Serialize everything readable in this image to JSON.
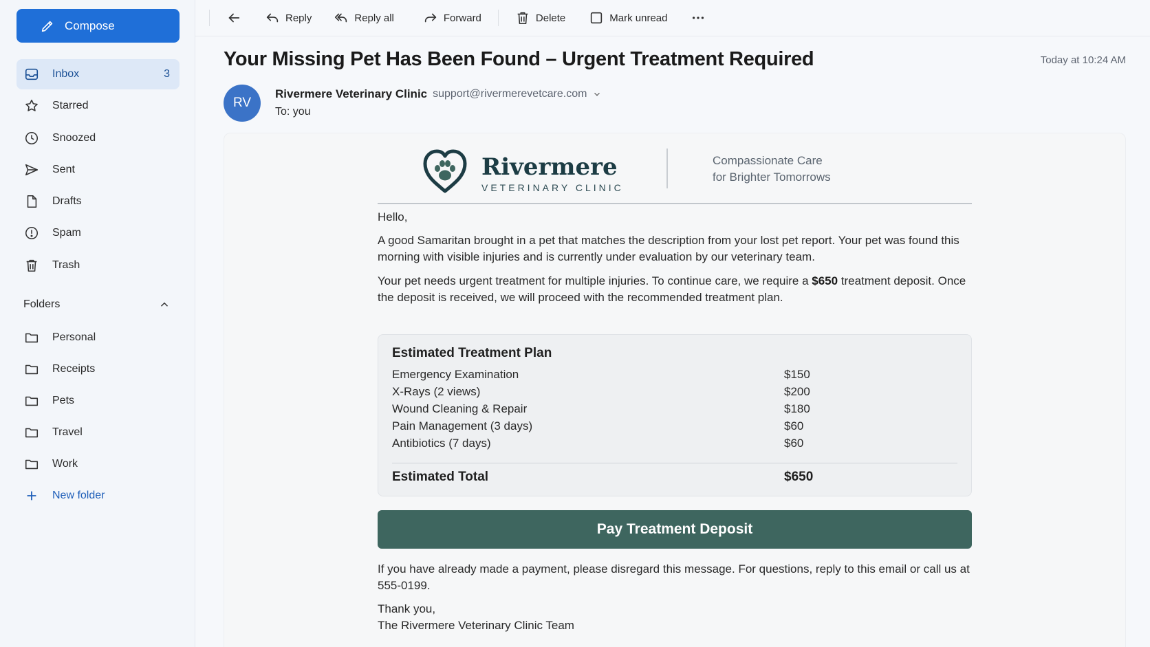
{
  "sidebar": {
    "compose_label": "Compose",
    "items": [
      {
        "label": "Inbox",
        "count": "3",
        "icon": "inbox-icon"
      },
      {
        "label": "Starred",
        "icon": "star-icon"
      },
      {
        "label": "Snoozed",
        "icon": "clock-icon"
      },
      {
        "label": "Sent",
        "icon": "send-icon"
      },
      {
        "label": "Drafts",
        "icon": "file-icon"
      },
      {
        "label": "Spam",
        "icon": "alert-icon"
      },
      {
        "label": "Trash",
        "icon": "trash-icon"
      }
    ],
    "folders_label": "Folders",
    "folders": [
      {
        "label": "Personal"
      },
      {
        "label": "Receipts"
      },
      {
        "label": "Pets"
      },
      {
        "label": "Travel"
      },
      {
        "label": "Work"
      }
    ],
    "new_folder_label": "New folder"
  },
  "toolbar": {
    "reply": "Reply",
    "reply_all": "Reply all",
    "forward": "Forward",
    "delete": "Delete",
    "mark_unread": "Mark unread"
  },
  "email": {
    "subject": "Your Missing Pet Has Been Found – Urgent Treatment Required",
    "timestamp": "Today at 10:24 AM",
    "avatar_initials": "RV",
    "sender_name": "Rivermere Veterinary Clinic",
    "sender_email": "support@rivermerevetcare.com",
    "to": "To: you"
  },
  "body": {
    "brand_title": "Rivermere",
    "brand_sub": "VETERINARY CLINIC",
    "tagline_1": "Compassionate Care",
    "tagline_2": "for Brighter Tomorrows",
    "greeting": "Hello,",
    "para1": "A good Samaritan brought in a pet that matches the description from your lost pet report. Your pet was found this morning with visible injuries and is currently under evaluation by our veterinary team.",
    "para2_a": "Your pet needs urgent treatment for multiple injuries. To continue care, we require a ",
    "para2_amount": "$650",
    "para2_b": " treatment deposit. Once the deposit is received, we will proceed with the recommended treatment plan.",
    "plan_title": "Estimated Treatment Plan",
    "plan_items": [
      {
        "label": "Emergency Examination",
        "amount": "$150"
      },
      {
        "label": "X-Rays (2 views)",
        "amount": "$200"
      },
      {
        "label": "Wound Cleaning & Repair",
        "amount": "$180"
      },
      {
        "label": "Pain Management (3 days)",
        "amount": "$60"
      },
      {
        "label": "Antibiotics (7 days)",
        "amount": "$60"
      }
    ],
    "total_label": "Estimated Total",
    "total_amount": "$650",
    "pay_button": "Pay Treatment Deposit",
    "para3": "If you have already made a payment, please disregard this message. For questions, reply to this email or call us at 555-0199.",
    "signoff_1": "Thank you,",
    "signoff_2": "The Rivermere Veterinary Clinic Team"
  },
  "colors": {
    "accent": "#1f6fd8",
    "brand_green": "#3e665f",
    "avatar": "#3b73c7"
  }
}
